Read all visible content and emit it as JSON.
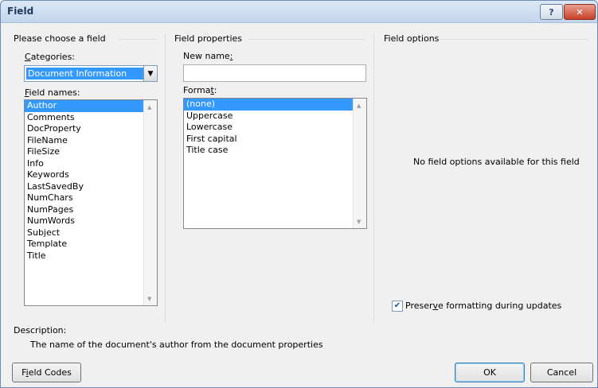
{
  "window": {
    "title": "Field",
    "help_glyph": "?",
    "close_glyph": "✕"
  },
  "left": {
    "group_title": "Please choose a field",
    "categories_label": "Categories:",
    "categories_selected": "Document Information",
    "field_names_label": "Field names:",
    "field_names": [
      "Author",
      "Comments",
      "DocProperty",
      "FileName",
      "FileSize",
      "Info",
      "Keywords",
      "LastSavedBy",
      "NumChars",
      "NumPages",
      "NumWords",
      "Subject",
      "Template",
      "Title"
    ],
    "selected_index": 0
  },
  "middle": {
    "group_title": "Field properties",
    "new_name_label": "New name:",
    "new_name_value": "",
    "format_label": "Format:",
    "formats": [
      "(none)",
      "Uppercase",
      "Lowercase",
      "First capital",
      "Title case"
    ],
    "selected_index": 0
  },
  "right": {
    "group_title": "Field options",
    "no_options_text": "No field options available for this field",
    "preserve_label": "Preserve formatting during updates",
    "preserve_checked": true
  },
  "description": {
    "label": "Description:",
    "text": "The name of the document's author from the document properties"
  },
  "buttons": {
    "field_codes": "Field Codes",
    "ok": "OK",
    "cancel": "Cancel"
  }
}
